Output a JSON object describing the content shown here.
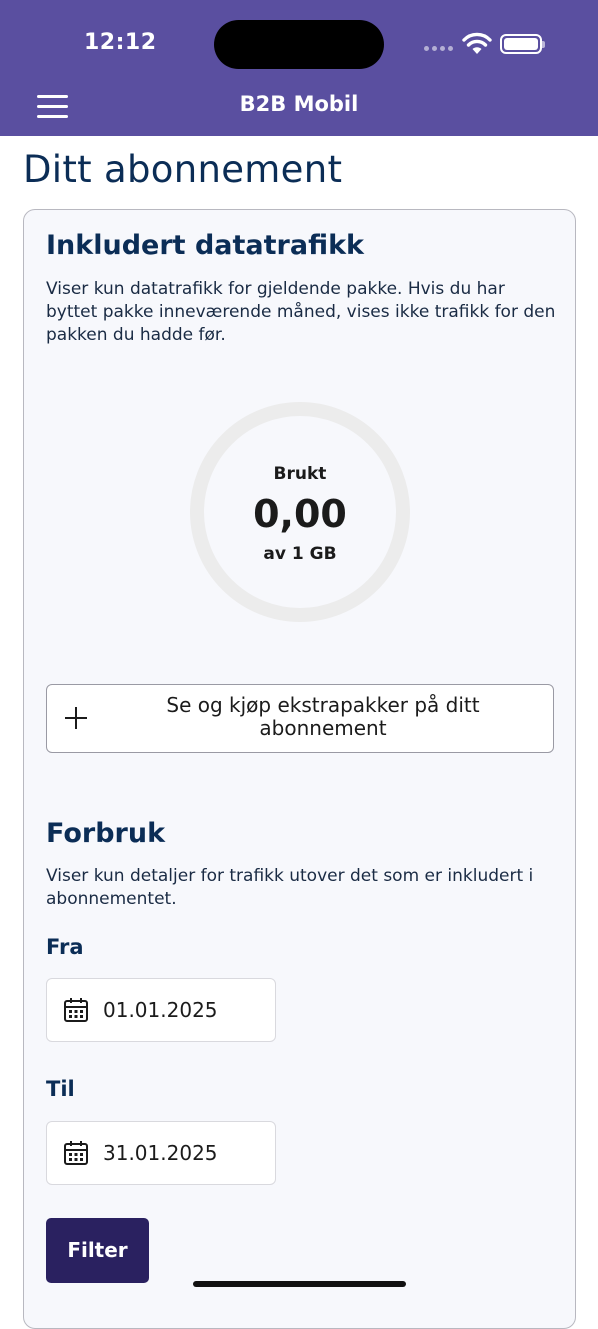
{
  "status_bar": {
    "time": "12:12"
  },
  "header": {
    "title": "B2B Mobil",
    "menu_icon": "hamburger-menu-icon"
  },
  "page": {
    "title": "Ditt abonnement"
  },
  "included_data": {
    "title": "Inkludert datatrafikk",
    "description": "Viser kun datatrafikk for gjeldende pakke. Hvis du har byttet pakke inneværende måned, vises ikke trafikk for den pakken du hadde før.",
    "gauge": {
      "label": "Brukt",
      "value": "0,00",
      "total": "av 1 GB",
      "used_fraction": 0
    }
  },
  "extra_packages_button": {
    "label": "Se og kjøp ekstrapakker på ditt abonnement",
    "icon": "plus-icon"
  },
  "usage": {
    "title": "Forbruk",
    "description": "Viser kun detaljer for trafikk utover det som er inkludert i abonnementet.",
    "from": {
      "label": "Fra",
      "value": "01.01.2025",
      "icon": "calendar-icon"
    },
    "to": {
      "label": "Til",
      "value": "31.01.2025",
      "icon": "calendar-icon"
    },
    "filter_label": "Filter"
  },
  "colors": {
    "header_bg": "#5a4fa0",
    "title_text": "#0b2d56",
    "primary_button": "#2a2160"
  }
}
